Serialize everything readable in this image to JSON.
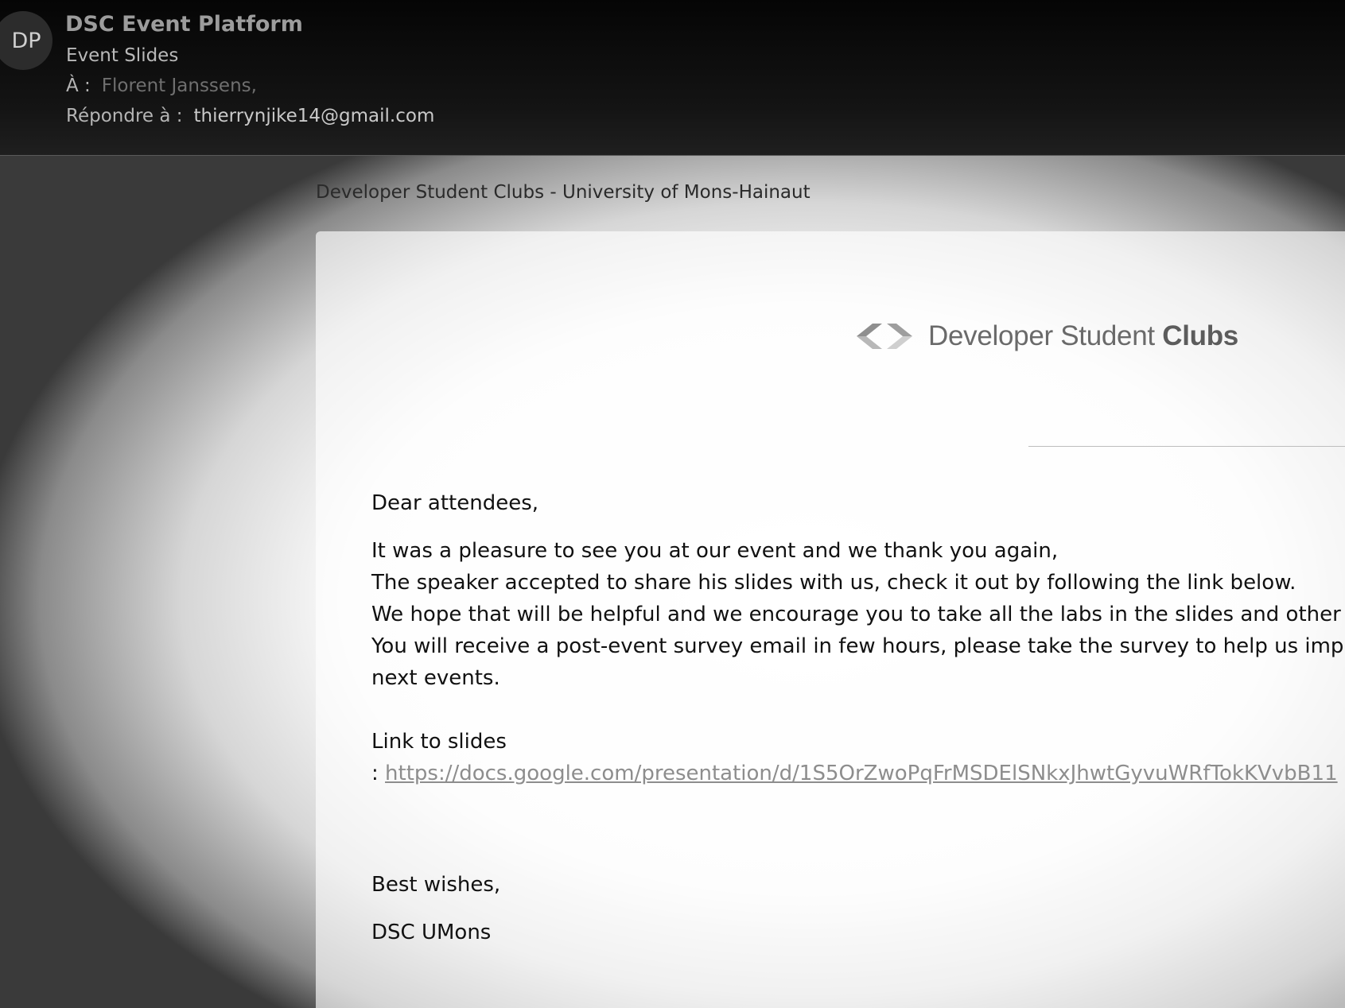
{
  "header": {
    "avatar_initials": "DP",
    "sender": "DSC Event Platform",
    "subject": "Event Slides",
    "to_label": "À :",
    "to_value": "Florent Janssens,",
    "reply_to_label": "Répondre à :",
    "reply_to_value": "thierrynjike14@gmail.com"
  },
  "body": {
    "organization": "Developer Student Clubs - University of Mons-Hainaut",
    "logo": {
      "text_light": "Developer Student",
      "text_bold": "Clubs",
      "icon": "dsc-brackets-logo-icon"
    },
    "greeting": "Dear attendees,",
    "paragraph_lines": [
      "It was a pleasure to see you at our event and we thank you again,",
      "The speaker accepted to share his slides with us, check it out by following the link below.",
      "We hope that will be helpful and we encourage you to take all the labs in the slides and other l",
      "You will receive a post-event survey email in few hours, please take the survey to help us impro",
      "next events."
    ],
    "link_label": "Link to slides",
    "link_prefix": ":",
    "link_text": "https://docs.google.com/presentation/d/1S5OrZwoPqFrMSDElSNkxJhwtGyvuWRfTokKVvbB11",
    "closing": "Best wishes,",
    "signature": "DSC UMons"
  },
  "colors": {
    "header_bg": "#0b0b0b",
    "link": "#8d8d8d",
    "text": "#111111"
  }
}
